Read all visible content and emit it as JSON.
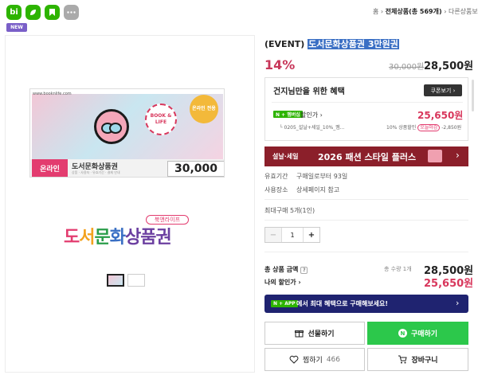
{
  "topbar": {
    "apps": [
      {
        "label": "bi",
        "icon": "bi-logo-icon",
        "color": "#2db400"
      },
      {
        "label": "",
        "icon": "leaf-app-icon",
        "color": "#2db400"
      },
      {
        "label": "",
        "icon": "bookmark-app-icon",
        "color": "#2db400"
      },
      {
        "label": "",
        "icon": "more-apps-icon",
        "color": "#999999"
      }
    ],
    "breadcrumb": {
      "home": "홈",
      "sep": "›",
      "all": "전체상품(총 569개)",
      "last": "다른상품보기"
    }
  },
  "badge": {
    "new": "NEW"
  },
  "ticket": {
    "url": "www.booknlife.com",
    "stamp": "온라인 전용",
    "book_life": "BOOK & LIFE",
    "online": "온라인",
    "name": "도서문화상품권",
    "sub": "상품 · 사용처 · 유효기간 · 결제 안내",
    "amount": "30,000"
  },
  "logo": {
    "tag": "북앤라이프",
    "word_parts": [
      "도",
      "서",
      "문",
      "화",
      "상품권"
    ]
  },
  "product": {
    "title_prefix": "(EVENT)",
    "title": "도서문화상품권 3만원권",
    "discount": "14%",
    "original_price": "30,000원",
    "price": "28,500원"
  },
  "benefit": {
    "title": "건지님만을 위한 혜택",
    "coupon_btn": "쿠폰보기 ›",
    "npay_badge": "N + 멤버십",
    "discount_label": "할인가 ›",
    "discount_price": "25,650원",
    "row2_label": "0205_설날+세일_10%_멤...",
    "row2_right": "10% 상품할인",
    "row2_pill": "오늘마감",
    "row2_amount": "-2,850원"
  },
  "banner": {
    "left": "설날·세일",
    "center": "2026 패션 스타일 플러스",
    "arrow": "›"
  },
  "info": {
    "valid_label": "유효기간",
    "valid_value": "구매일로부터 93일",
    "place_label": "사용장소",
    "place_value": "상세페이지 참고",
    "max_purchase": "최대구매 5개(1인)"
  },
  "quantity": {
    "minus": "−",
    "value": "1",
    "plus": "+"
  },
  "totals": {
    "label": "총 상품 금액",
    "help": "?",
    "count": "총 수량 1개",
    "amount": "28,500원",
    "my_discount_label": "나의 할인가 ›",
    "my_discount_amount": "25,650원"
  },
  "adbar": {
    "badge": "N + APP",
    "text": "에서 최대 혜택으로 구매해보세요!",
    "arrow": "›"
  },
  "actions": {
    "gift": "선물하기",
    "buy": "구매하기",
    "buy_icon": "N",
    "zzim": "찜하기",
    "zzim_count": "466",
    "cart": "장바구니"
  }
}
